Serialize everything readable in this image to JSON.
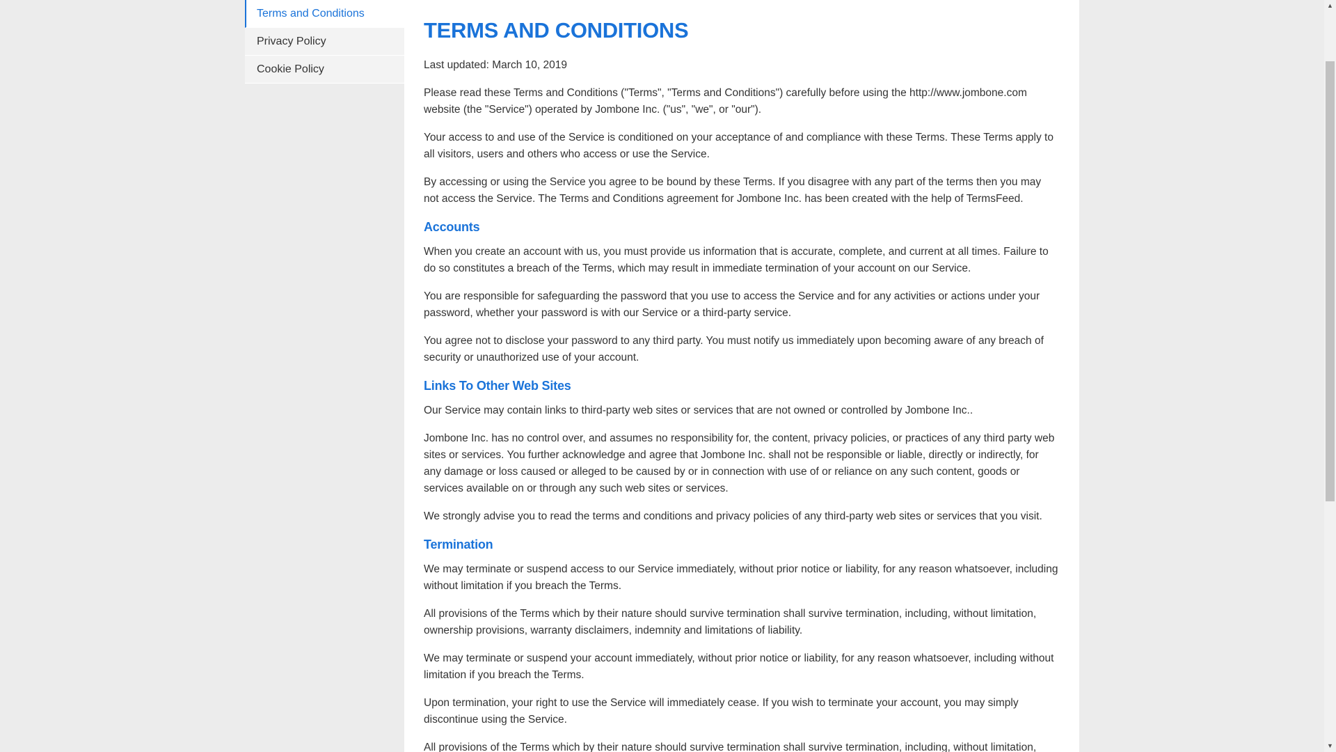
{
  "sidebar": {
    "items": [
      {
        "label": "Terms and Conditions"
      },
      {
        "label": "Privacy Policy"
      },
      {
        "label": "Cookie Policy"
      }
    ]
  },
  "main": {
    "title": "TERMS AND CONDITIONS",
    "last_updated": "Last updated: March 10, 2019",
    "intro": [
      "Please read these Terms and Conditions (\"Terms\", \"Terms and Conditions\") carefully before using the http://www.jombone.com website (the \"Service\") operated by Jombone Inc. (\"us\", \"we\", or \"our\").",
      "Your access to and use of the Service is conditioned on your acceptance of and compliance with these Terms. These Terms apply to all visitors, users and others who access or use the Service.",
      "By accessing or using the Service you agree to be bound by these Terms. If you disagree with any part of the terms then you may not access the Service. The Terms and Conditions agreement for Jombone Inc. has been created with the help of TermsFeed."
    ],
    "sections": [
      {
        "heading": "Accounts",
        "paragraphs": [
          "When you create an account with us, you must provide us information that is accurate, complete, and current at all times. Failure to do so constitutes a breach of the Terms, which may result in immediate termination of your account on our Service.",
          "You are responsible for safeguarding the password that you use to access the Service and for any activities or actions under your password, whether your password is with our Service or a third-party service.",
          "You agree not to disclose your password to any third party. You must notify us immediately upon becoming aware of any breach of security or unauthorized use of your account."
        ]
      },
      {
        "heading": "Links To Other Web Sites",
        "paragraphs": [
          "Our Service may contain links to third-party web sites or services that are not owned or controlled by Jombone Inc..",
          "Jombone Inc. has no control over, and assumes no responsibility for, the content, privacy policies, or practices of any third party web sites or services. You further acknowledge and agree that Jombone Inc. shall not be responsible or liable, directly or indirectly, for any damage or loss caused or alleged to be caused by or in connection with use of or reliance on any such content, goods or services available on or through any such web sites or services.",
          "We strongly advise you to read the terms and conditions and privacy policies of any third-party web sites or services that you visit."
        ]
      },
      {
        "heading": "Termination",
        "paragraphs": [
          "We may terminate or suspend access to our Service immediately, without prior notice or liability, for any reason whatsoever, including without limitation if you breach the Terms.",
          "All provisions of the Terms which by their nature should survive termination shall survive termination, including, without limitation, ownership provisions, warranty disclaimers, indemnity and limitations of liability.",
          "We may terminate or suspend your account immediately, without prior notice or liability, for any reason whatsoever, including without limitation if you breach the Terms.",
          "Upon termination, your right to use the Service will immediately cease. If you wish to terminate your account, you may simply discontinue using the Service.",
          "All provisions of the Terms which by their nature should survive termination shall survive termination, including, without limitation,"
        ]
      }
    ]
  },
  "scrollbar": {
    "up_icon": "▲",
    "down_icon": "▼"
  },
  "colors": {
    "accent": "#1a73d9",
    "text": "#333333",
    "page_background": "#ececec",
    "sidebar_item_background": "#f3f3f3"
  }
}
